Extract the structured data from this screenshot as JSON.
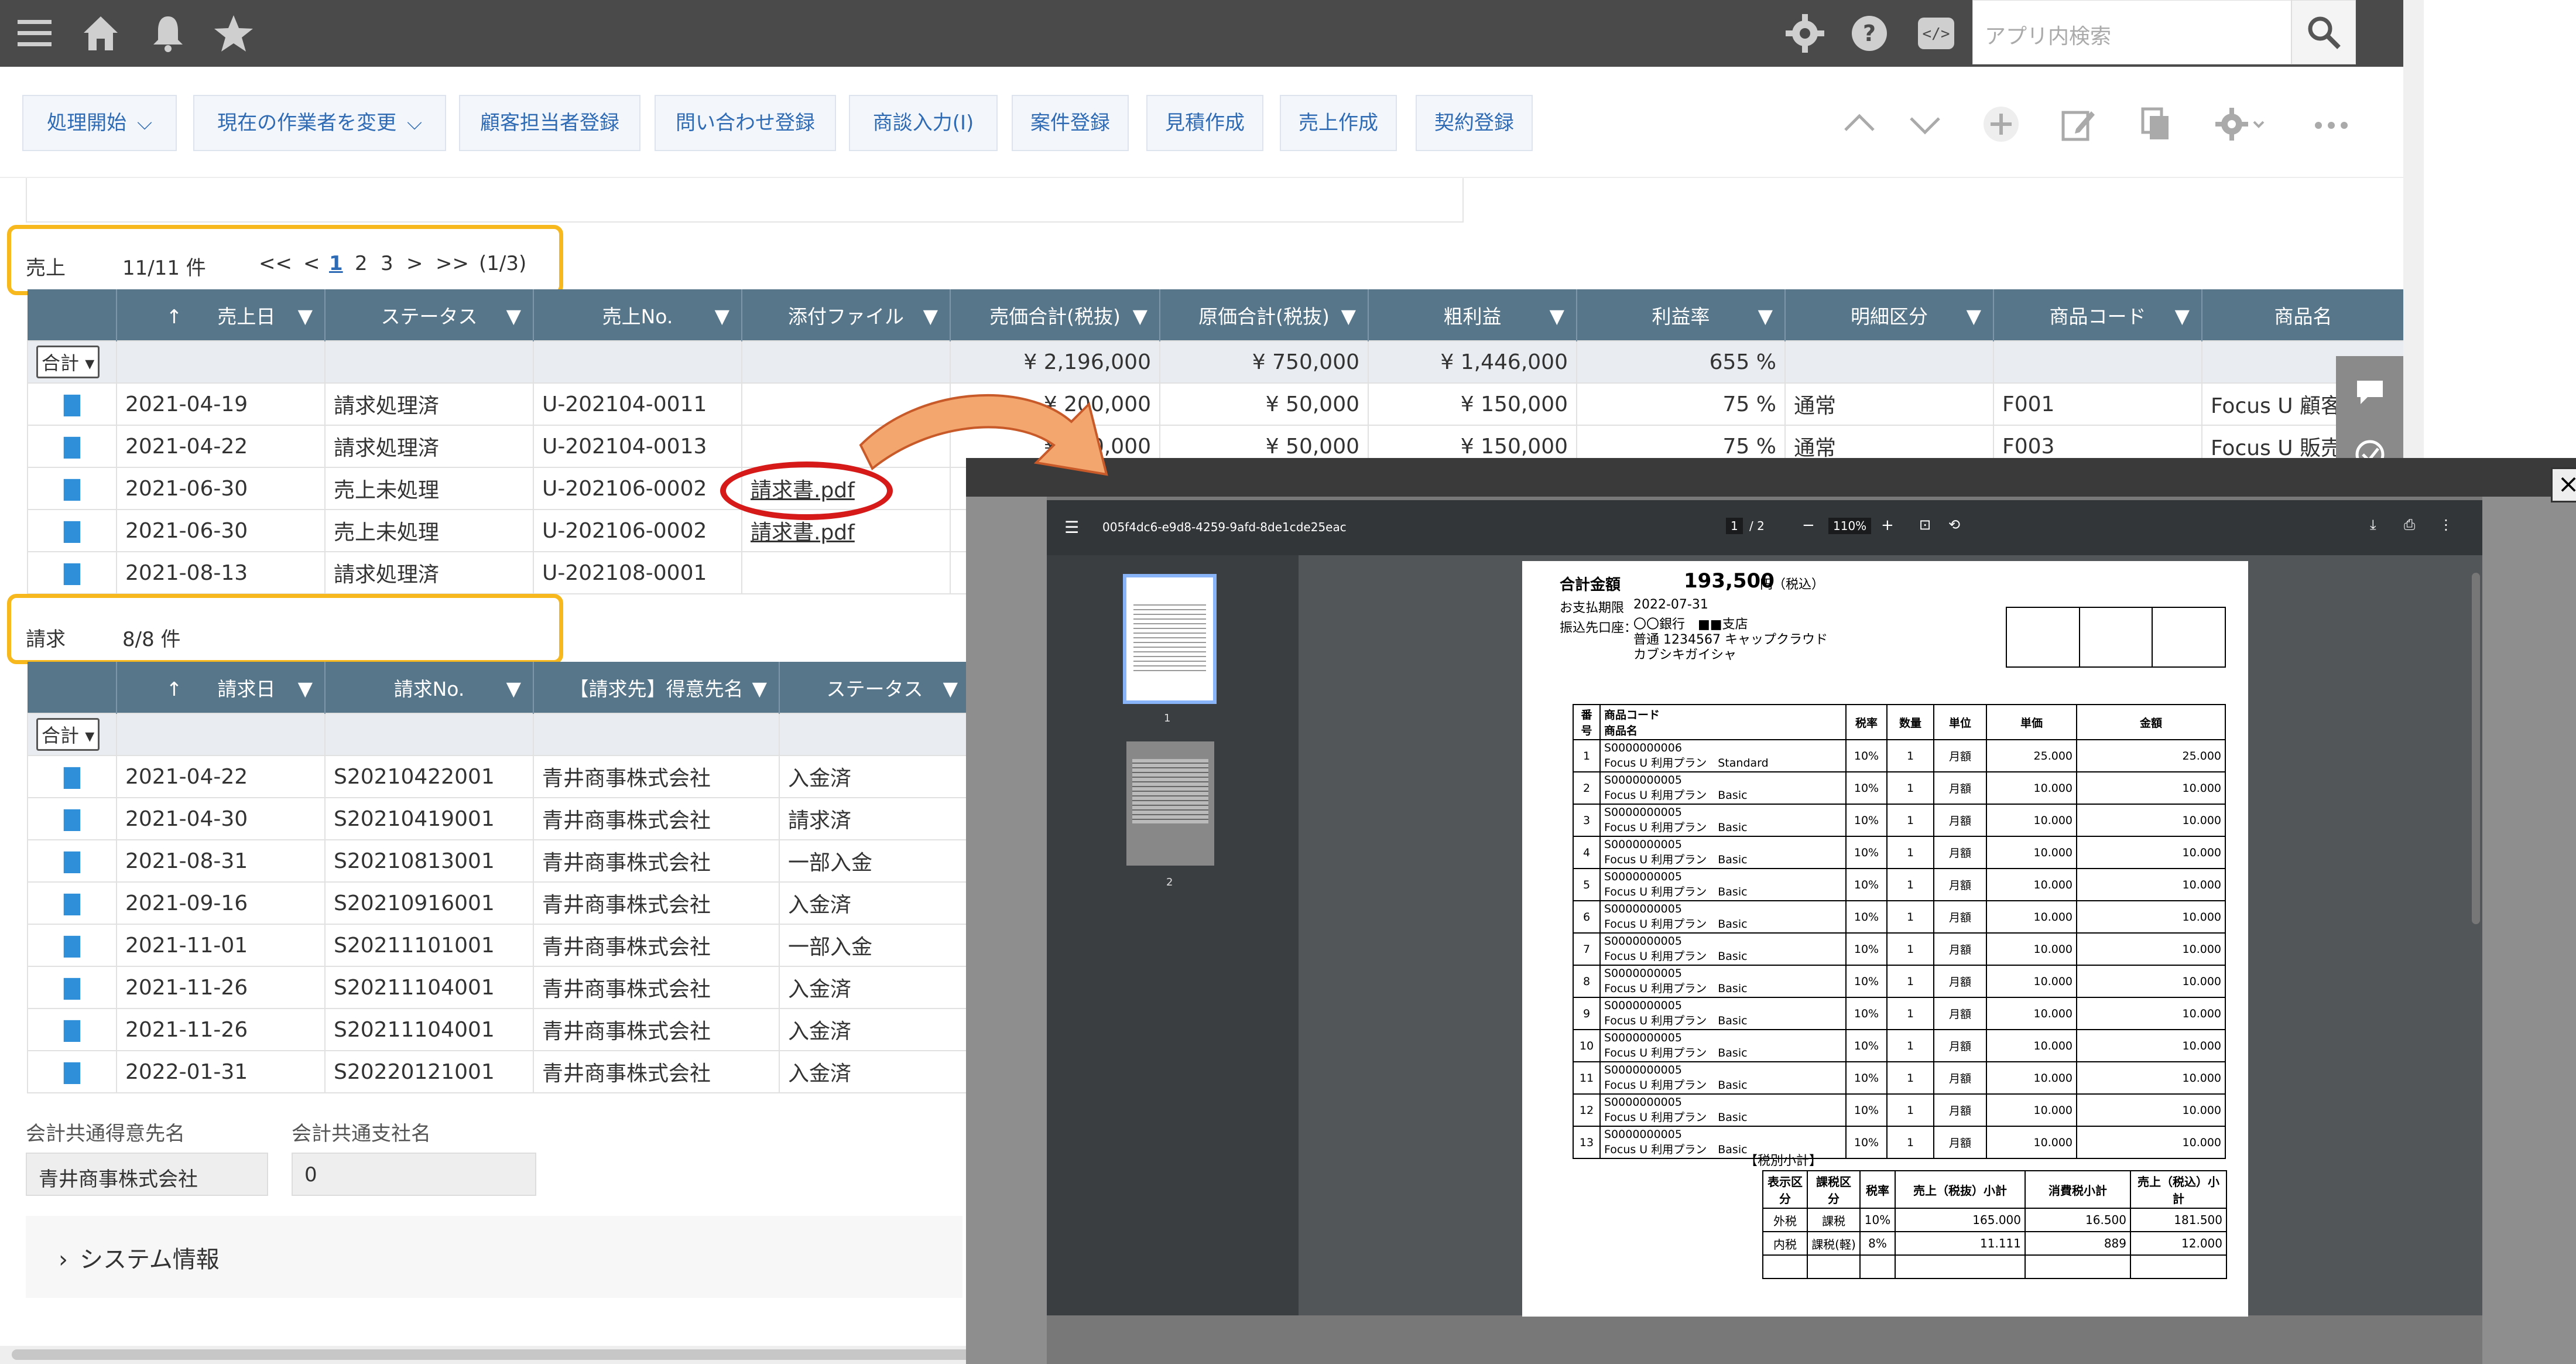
{
  "search": {
    "placeholder": "アプリ内検索"
  },
  "toolbar": {
    "buttons": [
      {
        "label": "処理開始",
        "dropdown": true
      },
      {
        "label": "現在の作業者を変更",
        "dropdown": true
      },
      {
        "label": "顧客担当者登録"
      },
      {
        "label": "問い合わせ登録"
      },
      {
        "label": "商談入力(I)"
      },
      {
        "label": "案件登録"
      },
      {
        "label": "見積作成"
      },
      {
        "label": "売上作成"
      },
      {
        "label": "契約登録"
      }
    ]
  },
  "sales": {
    "title": "売上",
    "count": "11/11 件",
    "pager": {
      "first": "<<",
      "prev": "<",
      "pages": [
        "1",
        "2",
        "3"
      ],
      "next": ">",
      "last": ">>",
      "info": "(1/3)"
    },
    "columns": [
      "売上日",
      "ステータス",
      "売上No.",
      "添付ファイル",
      "売価合計(税抜)",
      "原価合計(税抜)",
      "粗利益",
      "利益率",
      "明細区分",
      "商品コード",
      "商品名"
    ],
    "sum_label": "合計",
    "totals": {
      "price": "¥ 2,196,000",
      "cost": "¥ 750,000",
      "gross": "¥ 1,446,000",
      "rate": "655 %"
    },
    "rows": [
      {
        "date": "2021-04-19",
        "status": "請求処理済",
        "no": "U-202104-0011",
        "file": "",
        "price": "¥ 200,000",
        "cost": "¥ 50,000",
        "gross": "¥ 150,000",
        "rate": "75 %",
        "kind": "通常",
        "code": "F001",
        "name": "Focus U 顧客管理"
      },
      {
        "date": "2021-04-22",
        "status": "請求処理済",
        "no": "U-202104-0013",
        "file": "",
        "price": "¥ 200,000",
        "cost": "¥ 50,000",
        "gross": "¥ 150,000",
        "rate": "75 %",
        "kind": "通常",
        "code": "F003",
        "name": "Focus U 販売管理"
      },
      {
        "date": "2021-06-30",
        "status": "売上未処理",
        "no": "U-202106-0002",
        "file": "請求書.pdf"
      },
      {
        "date": "2021-06-30",
        "status": "売上未処理",
        "no": "U-202106-0002",
        "file": "請求書.pdf"
      },
      {
        "date": "2021-08-13",
        "status": "請求処理済",
        "no": "U-202108-0001",
        "file": ""
      }
    ]
  },
  "invoices": {
    "title": "請求",
    "count": "8/8 件",
    "columns": [
      "請求日",
      "請求No.",
      "【請求先】得意先名",
      "ステータス"
    ],
    "sum_label": "合計",
    "rows": [
      {
        "date": "2021-04-22",
        "no": "S20210422001",
        "customer": "青井商事株式会社",
        "status": "入金済"
      },
      {
        "date": "2021-04-30",
        "no": "S20210419001",
        "customer": "青井商事株式会社",
        "status": "請求済"
      },
      {
        "date": "2021-08-31",
        "no": "S20210813001",
        "customer": "青井商事株式会社",
        "status": "一部入金"
      },
      {
        "date": "2021-09-16",
        "no": "S20210916001",
        "customer": "青井商事株式会社",
        "status": "入金済"
      },
      {
        "date": "2021-11-01",
        "no": "S20211101001",
        "customer": "青井商事株式会社",
        "status": "一部入金"
      },
      {
        "date": "2021-11-26",
        "no": "S20211104001",
        "customer": "青井商事株式会社",
        "status": "入金済"
      },
      {
        "date": "2021-11-26",
        "no": "S20211104001",
        "customer": "青井商事株式会社",
        "status": "入金済"
      },
      {
        "date": "2022-01-31",
        "no": "S20220121001",
        "customer": "青井商事株式会社",
        "status": "入金済"
      }
    ]
  },
  "fields": {
    "customer_label": "会計共通得意先名",
    "customer_value": "青井商事株式会社",
    "payee_label": "会計共通支社名",
    "payee_value": "0"
  },
  "system_info": "システム情報",
  "pdf": {
    "filename": "005f4dc6-e9d8-4259-9afd-8de1cde25eac",
    "page_current": "1",
    "page_total": "/ 2",
    "zoom": "110%",
    "thumbs": [
      "1",
      "2"
    ],
    "total_label": "合計金額",
    "total_value": "193,500",
    "total_unit": "円（税込）",
    "due_label": "お支払期限",
    "due_value": "2022-07-31",
    "bank_label": "振込先口座：",
    "bank_line1": "〇〇銀行　■■支店",
    "bank_line2": "普通 1234567 キャップクラウド",
    "bank_line3": "カブシキガイシャ",
    "table_headers": {
      "no": "番号",
      "code": "商品コード",
      "name": "商品名",
      "tax": "税率",
      "qty": "数量",
      "unit": "単位",
      "price": "単価",
      "amount": "金額"
    },
    "lines": [
      {
        "no": "1",
        "code": "S0000000006",
        "name": "Focus U 利用プラン　Standard",
        "tax": "10%",
        "qty": "1",
        "unit": "月額",
        "price": "25.000",
        "amount": "25.000"
      },
      {
        "no": "2",
        "code": "S0000000005",
        "name": "Focus U 利用プラン　Basic",
        "tax": "10%",
        "qty": "1",
        "unit": "月額",
        "price": "10.000",
        "amount": "10.000"
      },
      {
        "no": "3",
        "code": "S0000000005",
        "name": "Focus U 利用プラン　Basic",
        "tax": "10%",
        "qty": "1",
        "unit": "月額",
        "price": "10.000",
        "amount": "10.000"
      },
      {
        "no": "4",
        "code": "S0000000005",
        "name": "Focus U 利用プラン　Basic",
        "tax": "10%",
        "qty": "1",
        "unit": "月額",
        "price": "10.000",
        "amount": "10.000"
      },
      {
        "no": "5",
        "code": "S0000000005",
        "name": "Focus U 利用プラン　Basic",
        "tax": "10%",
        "qty": "1",
        "unit": "月額",
        "price": "10.000",
        "amount": "10.000"
      },
      {
        "no": "6",
        "code": "S0000000005",
        "name": "Focus U 利用プラン　Basic",
        "tax": "10%",
        "qty": "1",
        "unit": "月額",
        "price": "10.000",
        "amount": "10.000"
      },
      {
        "no": "7",
        "code": "S0000000005",
        "name": "Focus U 利用プラン　Basic",
        "tax": "10%",
        "qty": "1",
        "unit": "月額",
        "price": "10.000",
        "amount": "10.000"
      },
      {
        "no": "8",
        "code": "S0000000005",
        "name": "Focus U 利用プラン　Basic",
        "tax": "10%",
        "qty": "1",
        "unit": "月額",
        "price": "10.000",
        "amount": "10.000"
      },
      {
        "no": "9",
        "code": "S0000000005",
        "name": "Focus U 利用プラン　Basic",
        "tax": "10%",
        "qty": "1",
        "unit": "月額",
        "price": "10.000",
        "amount": "10.000"
      },
      {
        "no": "10",
        "code": "S0000000005",
        "name": "Focus U 利用プラン　Basic",
        "tax": "10%",
        "qty": "1",
        "unit": "月額",
        "price": "10.000",
        "amount": "10.000"
      },
      {
        "no": "11",
        "code": "S0000000005",
        "name": "Focus U 利用プラン　Basic",
        "tax": "10%",
        "qty": "1",
        "unit": "月額",
        "price": "10.000",
        "amount": "10.000"
      },
      {
        "no": "12",
        "code": "S0000000005",
        "name": "Focus U 利用プラン　Basic",
        "tax": "10%",
        "qty": "1",
        "unit": "月額",
        "price": "10.000",
        "amount": "10.000"
      },
      {
        "no": "13",
        "code": "S0000000005",
        "name": "Focus U 利用プラン　Basic",
        "tax": "10%",
        "qty": "1",
        "unit": "月額",
        "price": "10.000",
        "amount": "10.000"
      }
    ],
    "tax_title": "【税別小計】",
    "tax_headers": [
      "表示区分",
      "課税区分",
      "税率",
      "売上（税抜）小計",
      "消費税小計",
      "売上（税込）小計"
    ],
    "tax_rows": [
      [
        "外税",
        "課税",
        "10%",
        "165.000",
        "16.500",
        "181.500"
      ],
      [
        "内税",
        "課税(軽)",
        "8%",
        "11.111",
        "889",
        "12.000"
      ]
    ]
  },
  "colors": {
    "topbar": "#4a4a4a",
    "header": "#57768a",
    "accent": "#2f6bb5",
    "highlight_orange": "#f6b81d",
    "highlight_red": "#d61a1a",
    "arrow": "#f0a070"
  }
}
